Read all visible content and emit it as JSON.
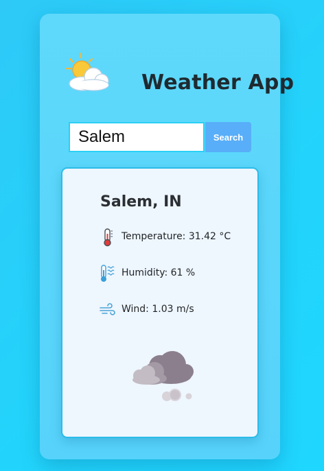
{
  "app": {
    "title": "Weather App",
    "logo_icon": "sun-behind-cloud-icon"
  },
  "search": {
    "value": "Salem",
    "placeholder": "",
    "button_label": "Search"
  },
  "weather": {
    "city": "Salem, IN",
    "temperature": "Temperature: 31.42 °C",
    "humidity": "Humidity: 61 %",
    "wind": "Wind: 1.03 m/s",
    "condition_icon": "cloudy-rain-clouds-icon"
  },
  "colors": {
    "background": "#22d4fb",
    "panel": "#5ed9fb",
    "button": "#58aef9",
    "card": "#eef6fe",
    "card_border": "#2bbce8",
    "title_text": "#1f2a30"
  }
}
